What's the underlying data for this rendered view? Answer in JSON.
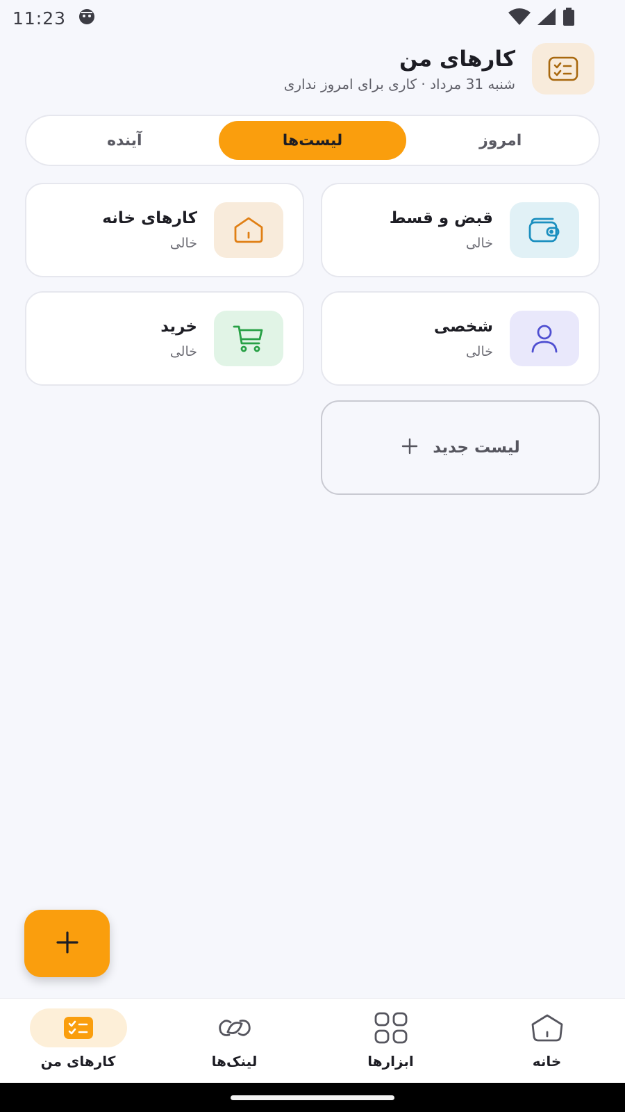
{
  "status": {
    "time": "11:23"
  },
  "header": {
    "title": "کارهای من",
    "subtitle": "شنبه 31 مرداد · کاری برای امروز نداری"
  },
  "tabs": [
    {
      "label": "امروز",
      "active": false
    },
    {
      "label": "لیست‌ها",
      "active": true
    },
    {
      "label": "آینده",
      "active": false
    }
  ],
  "lists": [
    {
      "title": "قبض و قسط",
      "subtitle": "خالی",
      "icon": "wallet-icon",
      "bg": "#e1f1f6",
      "color": "#1b8fbf"
    },
    {
      "title": "کارهای خانه",
      "subtitle": "خالی",
      "icon": "house-icon",
      "bg": "#f8ebdb",
      "color": "#e07f14"
    },
    {
      "title": "شخصی",
      "subtitle": "خالی",
      "icon": "person-icon",
      "bg": "#e9e8fb",
      "color": "#4f4fd1"
    },
    {
      "title": "خرید",
      "subtitle": "خالی",
      "icon": "cart-icon",
      "bg": "#e1f4e6",
      "color": "#27a045"
    }
  ],
  "new_list": {
    "label": "لیست جدید"
  },
  "bottom_nav": [
    {
      "label": "خانه",
      "icon": "home-icon",
      "active": false
    },
    {
      "label": "ابزارها",
      "icon": "grid-icon",
      "active": false
    },
    {
      "label": "لینک‌ها",
      "icon": "link-icon",
      "active": false
    },
    {
      "label": "کارهای من",
      "icon": "tasks-icon",
      "active": true
    }
  ],
  "colors": {
    "accent": "#fa9e0d",
    "background": "#f6f7fc"
  }
}
